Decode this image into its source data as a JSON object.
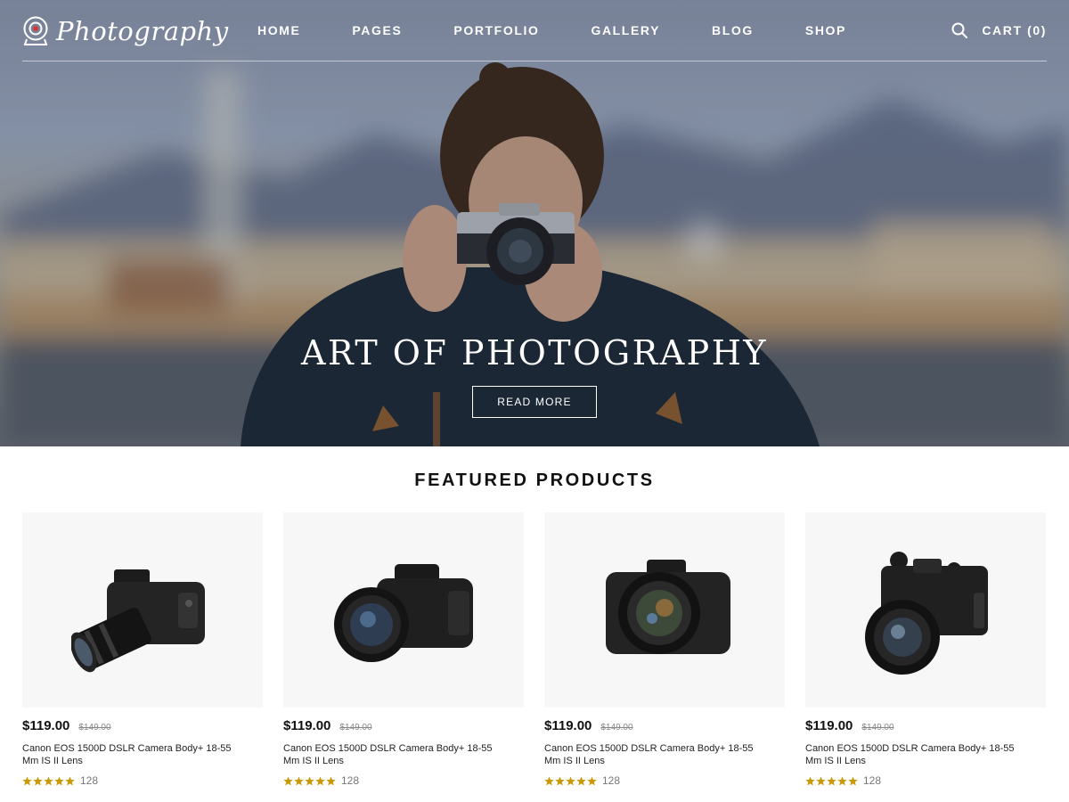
{
  "header": {
    "logo_text": "Photography",
    "nav": [
      "HOME",
      "PAGES",
      "PORTFOLIO",
      "GALLERY",
      "BLOG",
      "SHOP"
    ],
    "cart_label": "CART (0)"
  },
  "hero": {
    "title": "ART OF PHOTOGRAPHY",
    "button_label": "READ MORE"
  },
  "featured": {
    "title": "FEATURED PRODUCTS",
    "products": [
      {
        "price": "$119.00",
        "old_price": "$149.00",
        "name": "Canon EOS 1500D DSLR Camera Body+ 18-55 Mm IS II Lens",
        "rating": 5,
        "reviews": "128"
      },
      {
        "price": "$119.00",
        "old_price": "$149.00",
        "name": "Canon EOS 1500D DSLR Camera Body+ 18-55 Mm IS II Lens",
        "rating": 5,
        "reviews": "128"
      },
      {
        "price": "$119.00",
        "old_price": "$149.00",
        "name": "Canon EOS 1500D DSLR Camera Body+ 18-55 Mm IS II Lens",
        "rating": 5,
        "reviews": "128"
      },
      {
        "price": "$119.00",
        "old_price": "$149.00",
        "name": "Canon EOS 1500D DSLR Camera Body+ 18-55 Mm IS II Lens",
        "rating": 5,
        "reviews": "128"
      }
    ]
  },
  "colors": {
    "star": "#c99a06",
    "hero_text": "#ffffff",
    "card_bg": "#f7f7f7"
  },
  "icons": {
    "logo": "camera-logo-icon",
    "search": "search-icon",
    "star": "star-icon",
    "product": "dslr-camera-icon"
  }
}
